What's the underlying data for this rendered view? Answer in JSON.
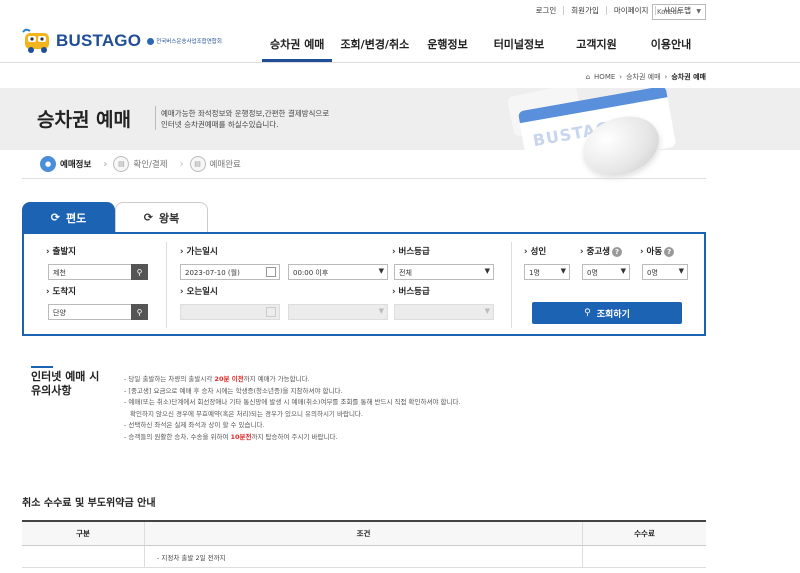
{
  "util": {
    "login": "로그인",
    "join": "회원가입",
    "mypage": "마이페이지",
    "sitemap": "사이트맵",
    "language": "Korean"
  },
  "logo": {
    "brand": "BUSTAGO",
    "org": "전국버스운송사업조합연합회"
  },
  "gnb": [
    "승차권 예매",
    "조회/변경/취소",
    "운행정보",
    "터미널정보",
    "고객지원",
    "이용안내"
  ],
  "breadcrumb": {
    "home": "HOME",
    "level1": "승차권 예매",
    "current": "승차권 예매"
  },
  "hero": {
    "title": "승차권 예매",
    "desc1": "예매가능한 좌석정보와 운행정보,간편한 결제방식으로",
    "desc2": "인터넷 승차권예매를 하실수있습니다.",
    "ticket_text": "BUSTAGO"
  },
  "steps": [
    "예매정보",
    "확인/결제",
    "예매완료"
  ],
  "tabs": {
    "oneway": "편도",
    "round": "왕복"
  },
  "form": {
    "departure_label": "출발지",
    "departure_value": "제천",
    "arrival_label": "도착지",
    "arrival_value": "단양",
    "go_date_label": "가는일시",
    "go_date_value": "2023-07-10 (월)",
    "go_time_value": "00:00 이후",
    "return_date_label": "오는일시",
    "grade_label1": "버스등급",
    "grade_value1": "전체",
    "grade_label2": "버스등급",
    "adult_label": "성인",
    "adult_value": "1명",
    "teen_label": "중고생",
    "teen_value": "0명",
    "child_label": "아동",
    "child_value": "0명",
    "submit": "조회하기"
  },
  "notice": {
    "title": "인터넷 예매 시 유의사항",
    "l1a": "- 당일 출발하는 차량의 출발시각 ",
    "l1red": "20분 이전",
    "l1b": "까지 예매가 가능합니다.",
    "l2": "- [중고생] 요금으로 예매 후 승차 시에는 학생증(청소년증)을 지참하셔야 합니다.",
    "l3": "- 예매(또는 취소)단계에서 회선장애나 기타 통신망에 발생 시 예매(취소)여부를 조회를 통해 반드시 직접 확인하셔야 합니다.",
    "l3b": "확인하지 않으신 경우에 무효예약(혹은 처리)되는 경우가 있으니 유의하시기 바랍니다.",
    "l4": "- 선택하신 좌석은 실제 좌석과 상이 할 수 있습니다.",
    "l5a": "- 승객들의 원활한 승차, 수송을 위하여 ",
    "l5red": "10분전",
    "l5b": "까지 탑승하여 주시기 바랍니다."
  },
  "cancel": {
    "title": "취소 수수료 및 부도위약금 안내",
    "col1": "구분",
    "col2": "조건",
    "col3": "수수료",
    "row1": "- 지정차 출발 2일 전까지"
  }
}
